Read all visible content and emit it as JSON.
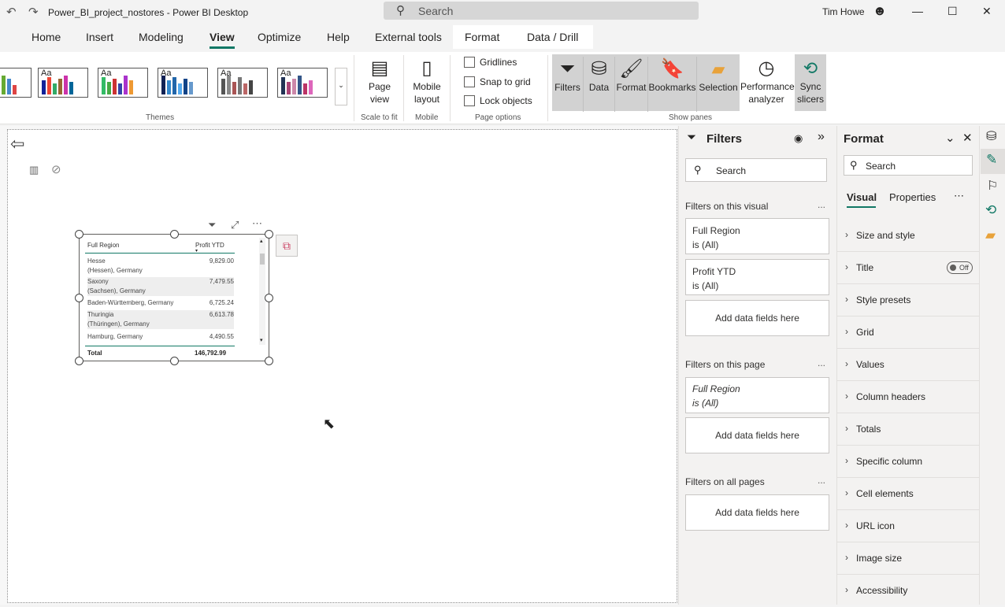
{
  "titlebar": {
    "title": "Power_BI_project_nostores - Power BI Desktop",
    "search_placeholder": "Search",
    "user": "Tim Howe"
  },
  "tabs": [
    "Home",
    "Insert",
    "Modeling",
    "View",
    "Optimize",
    "Help",
    "External tools",
    "Format",
    "Data / Drill"
  ],
  "active_tab": "View",
  "ribbon": {
    "themes_label": "Themes",
    "scale_to_fit_label": "Scale to fit",
    "page_view_label": "Page view",
    "mobile_layout_label": "Mobile layout",
    "mobile_label": "Mobile",
    "gridlines": "Gridlines",
    "snap_to_grid": "Snap to grid",
    "lock_objects": "Lock objects",
    "page_options_label": "Page options",
    "show_panes_label": "Show panes",
    "panes": [
      "Filters",
      "Data",
      "Format",
      "Bookmarks",
      "Selection"
    ],
    "performance_analyzer": "Performance analyzer",
    "sync_slicers": "Sync slicers",
    "theme_aa": "Aa"
  },
  "table_visual": {
    "col1_header": "Full Region",
    "col2_header": "Profit YTD",
    "rows": [
      {
        "region": "Hesse",
        "region2": "(Hessen), Germany",
        "profit": "9,829.00"
      },
      {
        "region": "Saxony",
        "region2": "(Sachsen), Germany",
        "profit": "7,479.55"
      },
      {
        "region": "Baden-Württemberg, Germany",
        "region2": "",
        "profit": "6,725.24"
      },
      {
        "region": "Thuringia",
        "region2": "(Thüringen), Germany",
        "profit": "6,613.78"
      },
      {
        "region": "Hamburg, Germany",
        "region2": "",
        "profit": "4,490.55"
      }
    ],
    "total_label": "Total",
    "total_value": "146,792.99"
  },
  "filters_pane": {
    "title": "Filters",
    "search_placeholder": "Search",
    "on_visual": "Filters on this visual",
    "card1_field": "Full Region",
    "card1_value": "is (All)",
    "card2_field": "Profit YTD",
    "card2_value": "is (All)",
    "add_fields": "Add data fields here",
    "on_page": "Filters on this page",
    "card3_field": "Full Region",
    "card3_value": "is (All)",
    "on_all_pages": "Filters on all pages",
    "more": "..."
  },
  "format_pane": {
    "title": "Format",
    "search_placeholder": "Search",
    "tab_visual": "Visual",
    "tab_properties": "Properties",
    "toggle_off": "Off",
    "sections": [
      "Size and style",
      "Title",
      "Style presets",
      "Grid",
      "Values",
      "Column headers",
      "Totals",
      "Specific column",
      "Cell elements",
      "URL icon",
      "Image size",
      "Accessibility"
    ]
  }
}
